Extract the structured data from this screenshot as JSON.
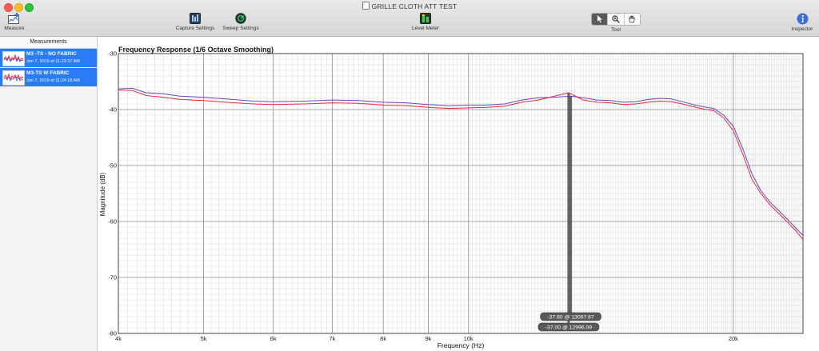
{
  "window": {
    "title": "GRILLE CLOTH ATT TEST"
  },
  "toolbar": {
    "measure": "Measure",
    "capture_settings": "Capture Settings",
    "sweep_settings": "Sweep Settings",
    "level_meter": "Level Meter",
    "tool": "Tool",
    "inspector": "Inspector"
  },
  "sidebar": {
    "header": "Measurements",
    "items": [
      {
        "name": "M3 -TS - NO FABRIC",
        "date": "Jan 7, 2019 at 11:23:37 AM"
      },
      {
        "name": "M3-TS W FABRIC",
        "date": "Jan 7, 2019 at 11:24:18 AM"
      }
    ]
  },
  "colors": {
    "series_1": "#6a46c8",
    "series_2": "#ee2a3a",
    "selection": "#2a7bf5",
    "cursor": "#4d4d4d"
  },
  "chart_data": {
    "type": "line",
    "title": "Frequency Response (1/6 Octave Smoothing)",
    "xlabel": "Frequency (Hz)",
    "ylabel": "Magnitude (dB)",
    "x_scale": "log",
    "xlim": [
      4000,
      24000
    ],
    "ylim": [
      -80,
      -30
    ],
    "x_ticks": [
      {
        "value": 4000,
        "label": "4k"
      },
      {
        "value": 5000,
        "label": "5k"
      },
      {
        "value": 6000,
        "label": "6k"
      },
      {
        "value": 7000,
        "label": "7k"
      },
      {
        "value": 8000,
        "label": "8k"
      },
      {
        "value": 9000,
        "label": "9k"
      },
      {
        "value": 10000,
        "label": "10k"
      },
      {
        "value": 20000,
        "label": "20k"
      }
    ],
    "y_ticks": [
      -30,
      -40,
      -50,
      -60,
      -70,
      -80
    ],
    "grid": true,
    "series": [
      {
        "name": "M3 -TS - NO FABRIC",
        "x": [
          4000,
          4150,
          4300,
          4500,
          4700,
          5000,
          5300,
          5700,
          6000,
          6500,
          7000,
          7500,
          8000,
          8500,
          9000,
          9500,
          10000,
          10500,
          11000,
          11500,
          12000,
          12500,
          13067.87,
          13500,
          14000,
          14500,
          15000,
          15500,
          16000,
          16500,
          17000,
          17500,
          18000,
          18500,
          19000,
          19500,
          20000,
          20500,
          21000,
          21500,
          22000,
          22500,
          23000,
          23500,
          24000
        ],
        "y": [
          -36.3,
          -36.2,
          -37.0,
          -37.2,
          -37.6,
          -37.8,
          -38.1,
          -38.5,
          -38.6,
          -38.5,
          -38.3,
          -38.4,
          -38.7,
          -38.8,
          -39.1,
          -39.3,
          -39.2,
          -39.2,
          -39.0,
          -38.3,
          -37.9,
          -37.8,
          -37.6,
          -37.9,
          -38.3,
          -38.4,
          -38.7,
          -38.6,
          -38.2,
          -38.0,
          -38.1,
          -38.6,
          -39.1,
          -39.5,
          -39.8,
          -41.0,
          -43.0,
          -47.0,
          -51.5,
          -54.5,
          -56.5,
          -58.0,
          -59.5,
          -61.0,
          -62.5
        ]
      },
      {
        "name": "M3-TS W FABRIC",
        "x": [
          4000,
          4150,
          4300,
          4500,
          4700,
          5000,
          5300,
          5700,
          6000,
          6500,
          7000,
          7500,
          8000,
          8500,
          9000,
          9500,
          10000,
          10500,
          11000,
          11500,
          12000,
          12996.09,
          13500,
          14000,
          14500,
          15000,
          15500,
          16000,
          16500,
          17000,
          17500,
          18000,
          18500,
          19000,
          19500,
          20000,
          20500,
          21000,
          21500,
          22000,
          22500,
          23000,
          23500,
          24000
        ],
        "y": [
          -36.5,
          -36.6,
          -37.5,
          -37.8,
          -38.2,
          -38.4,
          -38.7,
          -39.0,
          -39.1,
          -39.0,
          -38.8,
          -38.9,
          -39.2,
          -39.3,
          -39.6,
          -39.8,
          -39.7,
          -39.6,
          -39.4,
          -38.7,
          -38.3,
          -37.0,
          -38.3,
          -38.7,
          -38.8,
          -39.1,
          -39.0,
          -38.7,
          -38.5,
          -38.6,
          -39.0,
          -39.5,
          -39.9,
          -40.2,
          -41.5,
          -43.8,
          -48.0,
          -52.5,
          -55.0,
          -57.0,
          -58.5,
          -60.0,
          -61.5,
          -63.2
        ]
      }
    ],
    "cursor_readouts": [
      {
        "text": "-37.60 @ 13067.87",
        "x": 13067.87,
        "y": -37.6
      },
      {
        "text": "-37.00 @ 12996.09",
        "x": 12996.09,
        "y": -37.0
      }
    ]
  }
}
